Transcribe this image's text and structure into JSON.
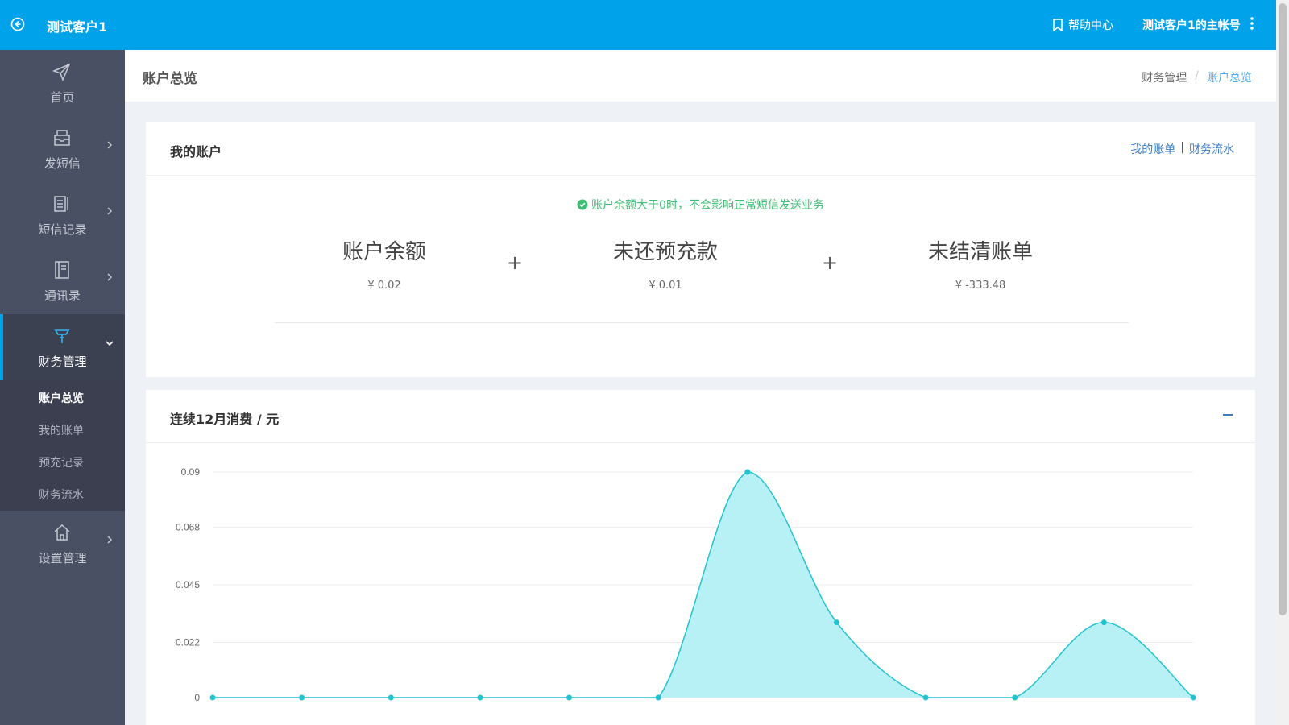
{
  "topbar": {
    "brand": "测试客户1",
    "help": "帮助中心",
    "account": "测试客户1的主帐号"
  },
  "sidebar": {
    "items": [
      {
        "label": "首页",
        "icon": "send-icon"
      },
      {
        "label": "发短信",
        "icon": "inbox-icon"
      },
      {
        "label": "短信记录",
        "icon": "log-icon"
      },
      {
        "label": "通讯录",
        "icon": "contacts-icon"
      },
      {
        "label": "财务管理",
        "icon": "finance-icon"
      },
      {
        "label": "设置管理",
        "icon": "home-icon"
      }
    ],
    "sub_items": [
      "账户总览",
      "我的账单",
      "预充记录",
      "财务流水"
    ]
  },
  "page": {
    "title": "账户总览",
    "breadcrumb": [
      "财务管理",
      "/",
      "账户总览"
    ]
  },
  "account_card": {
    "title": "我的账户",
    "links": [
      "我的账单",
      "|",
      "财务流水"
    ],
    "notice": "账户余额大于0时，不会影响正常短信发送业务",
    "plus": "+",
    "stats": [
      {
        "name": "账户余额",
        "value": "¥ 0.02"
      },
      {
        "name": "未还预充款",
        "value": "¥ 0.01"
      },
      {
        "name": "未结清账单",
        "value": "¥ -333.48"
      }
    ]
  },
  "spend_card": {
    "title": "连续12月消费 / 元"
  },
  "colors": {
    "topbar": "#00a2e9",
    "sidebar": "#4a5064",
    "accent": "#00a2e9",
    "success": "#3cbf73",
    "chart_line": "#22c3d0",
    "chart_fill": "#b8f1f5"
  },
  "chart_data": {
    "type": "area",
    "title": "连续12月消费 / 元",
    "y_ticks": [
      "0",
      "0.022",
      "0.045",
      "0.068",
      "0.09"
    ],
    "ylim": [
      0,
      0.09
    ],
    "grid": true,
    "values": [
      0,
      0,
      0,
      0,
      0,
      0,
      0.09,
      0.03,
      0,
      0,
      0.03,
      0
    ]
  }
}
